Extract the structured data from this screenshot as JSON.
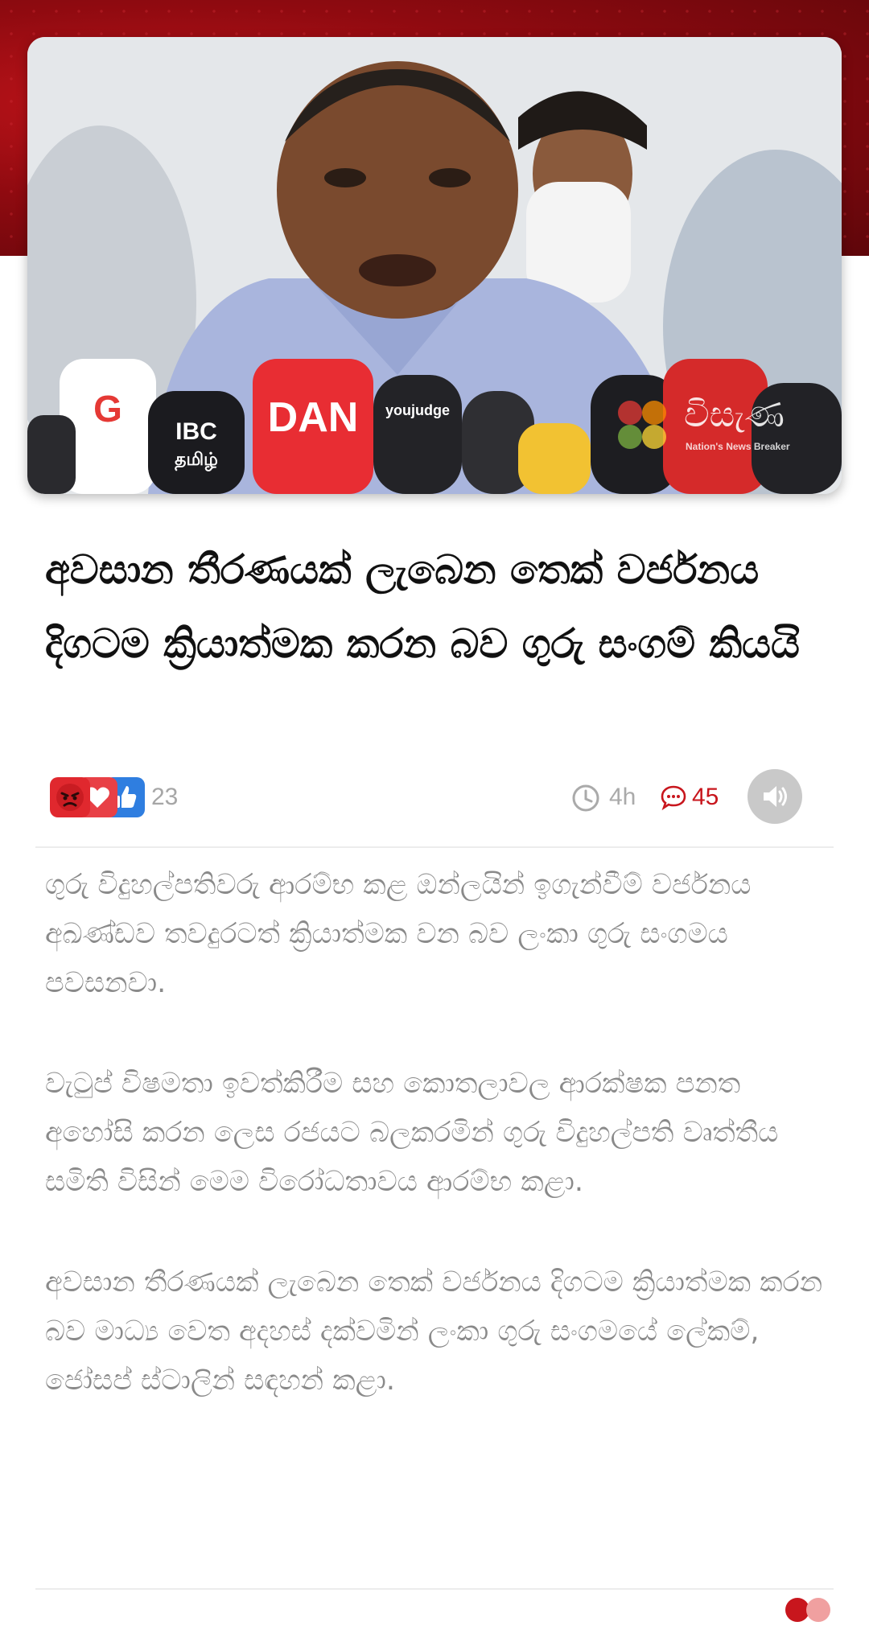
{
  "hero": {
    "watermark": {
      "title": "විසැණ",
      "tagline": "Nation's News Breaker",
      "dot_colors": [
        "#e53935",
        "#fb8c00",
        "#7cb342",
        "#fdd835"
      ]
    },
    "mic_logos": {
      "left_g": "G",
      "ibc": "IBC",
      "tamil": "தமிழ்",
      "dan": "DAN",
      "youjudge": "youjudge"
    }
  },
  "headline": "අවසාන තීරණයක් ලැබෙන තෙක් වර්ජනය දිගටම ක්‍රියාත්මක කරන බව ගුරු සංගම් කියයි",
  "meta": {
    "reaction_icons": [
      "angry-icon",
      "love-icon",
      "like-icon"
    ],
    "reaction_count": "23",
    "time": "4h",
    "comment_count": "45",
    "audio_icon": "speaker-icon"
  },
  "article": {
    "paragraphs": [
      "ගුරු විදුහල්පතිවරු ආරම්භ කළ ඔන්ලයින් ඉගැන්වීම් වර්ජනය අඛණ්ඩව තවදුරටත් ක්‍රියාත්මක වන බව ලංකා ගුරු සංගමය පවසනවා.",
      "වැටුප් විෂමතා ඉවත්කිරීම සහ කොතලාවල ආරක්ෂක පනත අහෝසි කරන ලෙස රජයට බලකරමින් ගුරු විදුහල්පති වෘත්තීය සමිති විසින් මෙම විරෝධතාවය ආරම්භ කළා.",
      "අවසාන තීරණයක් ලැබෙන තෙක් වර්ජනය දිගටම ක්‍රියාත්මක කරන බව මාධ්‍ය වෙත අදහස් දක්වමින් ලංකා ගුරු සංගමයේ ලේකම්, ජෝසප් ස්ටාලින් සඳහන් කළා."
    ]
  },
  "colors": {
    "accent": "#c8161d",
    "banner": "#8f0a10",
    "muted_text": "#8a8a8a"
  }
}
